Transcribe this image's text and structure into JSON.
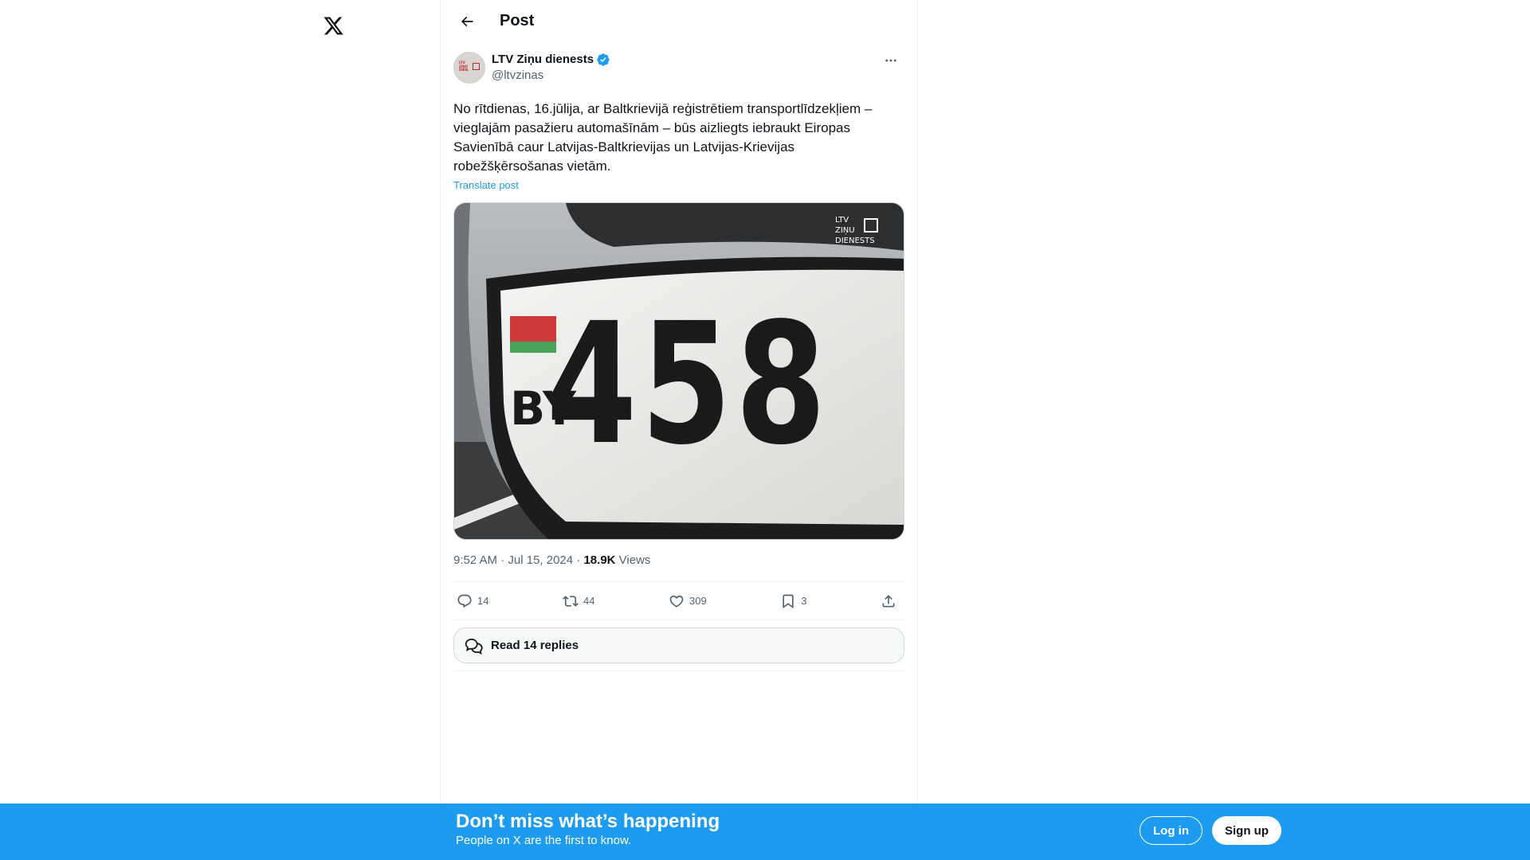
{
  "topbar": {
    "title": "Post"
  },
  "post": {
    "author_name": "LTV Ziņu dienests",
    "author_handle": "@ltvzinas",
    "text": "No rītdienas, 16.jūlija, ar Baltkrievijā reģistrētiem transportlīdzekļiem – vieglajām pasažieru automašīnām – būs aizliegts iebraukt Eiropas Savienībā caur Latvijas-Baltkrievijas un Latvijas-Krievijas robežšķērsošanas vietām.",
    "translate_label": "Translate post",
    "image": {
      "plate_country": "BY",
      "plate_number": "458",
      "watermark_lines": [
        "LTV",
        "ZIŅU",
        "DIENESTS"
      ]
    },
    "time": "9:52 AM",
    "date": "Jul 15, 2024",
    "views_count": "18.9K",
    "views_label": "Views",
    "replies": "14",
    "reposts": "44",
    "likes": "309",
    "bookmarks": "3",
    "read_replies_label": "Read 14 replies"
  },
  "banner": {
    "title": "Don’t miss what’s happening",
    "subtitle": "People on X are the first to know.",
    "login_label": "Log in",
    "signup_label": "Sign up"
  },
  "colors": {
    "accent": "#1d9bf0",
    "text": "#0f1419",
    "muted": "#536471"
  }
}
